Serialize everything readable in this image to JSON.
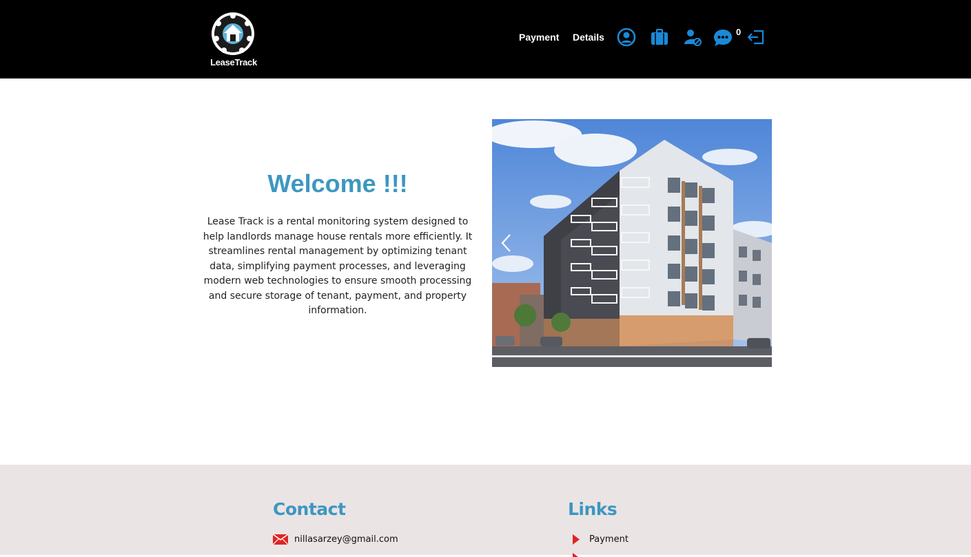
{
  "header": {
    "logo_text": "LeaseTrack",
    "nav": {
      "payment_label": "Payment",
      "details_label": "Details"
    },
    "icons": [
      "profile-icon",
      "briefcase-icon",
      "user-blocked-icon",
      "chat-icon",
      "logout-icon"
    ],
    "message_count": "0"
  },
  "main": {
    "title": "Welcome !!!",
    "description": "Lease Track is a rental monitoring system designed to help landlords manage house rentals more efficiently. It streamlines rental management by optimizing tenant data, simplifying payment processes, and leveraging modern web technologies to ensure smooth processing and secure storage of tenant, payment, and property information."
  },
  "footer": {
    "contact": {
      "heading": "Contact",
      "email": "nillasarzey@gmail.com"
    },
    "links": {
      "heading": "Links",
      "items": [
        "Payment"
      ]
    }
  },
  "colors": {
    "accent": "#3d97c0",
    "icon_blue": "#1a8ad8",
    "header_bg": "#000000",
    "footer_bg": "#ebe4e4",
    "link_arrow": "#e02424"
  }
}
